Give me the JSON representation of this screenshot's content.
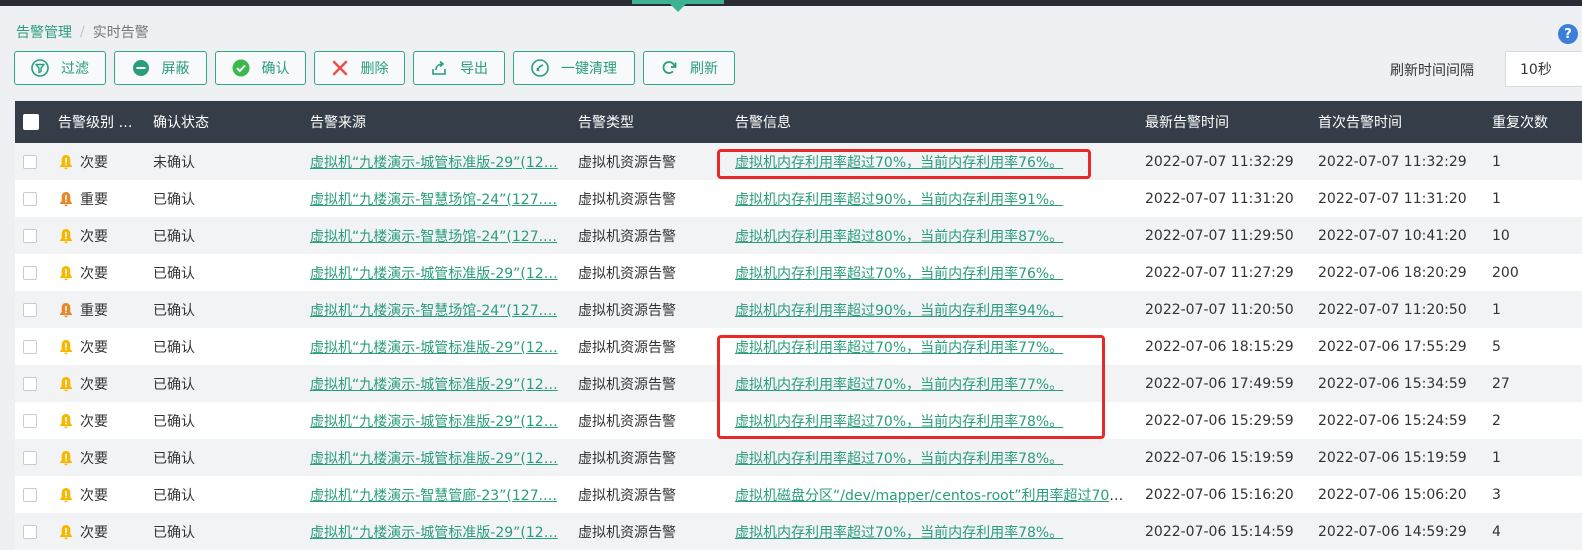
{
  "breadcrumb": {
    "parent": "告警管理",
    "separator": "/",
    "current": "实时告警"
  },
  "toolbar": {
    "filter": "过滤",
    "mask": "屏蔽",
    "confirm": "确认",
    "delete": "删除",
    "export": "导出",
    "clean": "一键清理",
    "refresh": "刷新"
  },
  "refresh_interval": {
    "label": "刷新时间间隔",
    "value": "10秒"
  },
  "colors": {
    "accent": "#2a9d7c",
    "header": "#353d49",
    "minor_level": "#f5b700",
    "major_level": "#e8862a",
    "highlight": "#e8292a"
  },
  "table": {
    "headers": [
      "告警级别 …",
      "确认状态",
      "告警来源",
      "告警类型",
      "告警信息",
      "最新告警时间",
      "首次告警时间",
      "重复次数"
    ],
    "rows": [
      {
        "level": "次要",
        "status": "未确认",
        "source": "虚拟机“九楼演示-城管标准版-29”(12…",
        "type": "虚拟机资源告警",
        "info": "虚拟机内存利用率超过70%，当前内存利用率76%。",
        "latest": "2022-07-07 11:32:29",
        "first": "2022-07-07 11:32:29",
        "repeat": "1"
      },
      {
        "level": "重要",
        "status": "已确认",
        "source": "虚拟机“九楼演示-智慧场馆-24”(127.…",
        "type": "虚拟机资源告警",
        "info": "虚拟机内存利用率超过90%，当前内存利用率91%。",
        "latest": "2022-07-07 11:31:20",
        "first": "2022-07-07 11:31:20",
        "repeat": "1"
      },
      {
        "level": "次要",
        "status": "已确认",
        "source": "虚拟机“九楼演示-智慧场馆-24”(127.…",
        "type": "虚拟机资源告警",
        "info": "虚拟机内存利用率超过80%，当前内存利用率87%。",
        "latest": "2022-07-07 11:29:50",
        "first": "2022-07-07 10:41:20",
        "repeat": "10"
      },
      {
        "level": "次要",
        "status": "已确认",
        "source": "虚拟机“九楼演示-城管标准版-29”(12…",
        "type": "虚拟机资源告警",
        "info": "虚拟机内存利用率超过70%，当前内存利用率76%。",
        "latest": "2022-07-07 11:27:29",
        "first": "2022-07-06 18:20:29",
        "repeat": "200"
      },
      {
        "level": "重要",
        "status": "已确认",
        "source": "虚拟机“九楼演示-智慧场馆-24”(127.…",
        "type": "虚拟机资源告警",
        "info": "虚拟机内存利用率超过90%，当前内存利用率94%。",
        "latest": "2022-07-07 11:20:50",
        "first": "2022-07-07 11:20:50",
        "repeat": "1"
      },
      {
        "level": "次要",
        "status": "已确认",
        "source": "虚拟机“九楼演示-城管标准版-29”(12…",
        "type": "虚拟机资源告警",
        "info": "虚拟机内存利用率超过70%，当前内存利用率77%。",
        "latest": "2022-07-06 18:15:29",
        "first": "2022-07-06 17:55:29",
        "repeat": "5"
      },
      {
        "level": "次要",
        "status": "已确认",
        "source": "虚拟机“九楼演示-城管标准版-29”(12…",
        "type": "虚拟机资源告警",
        "info": "虚拟机内存利用率超过70%，当前内存利用率77%。",
        "latest": "2022-07-06 17:49:59",
        "first": "2022-07-06 15:34:59",
        "repeat": "27"
      },
      {
        "level": "次要",
        "status": "已确认",
        "source": "虚拟机“九楼演示-城管标准版-29”(12…",
        "type": "虚拟机资源告警",
        "info": "虚拟机内存利用率超过70%，当前内存利用率78%。",
        "latest": "2022-07-06 15:29:59",
        "first": "2022-07-06 15:24:59",
        "repeat": "2"
      },
      {
        "level": "次要",
        "status": "已确认",
        "source": "虚拟机“九楼演示-城管标准版-29”(12…",
        "type": "虚拟机资源告警",
        "info": "虚拟机内存利用率超过70%，当前内存利用率78%。",
        "latest": "2022-07-06 15:19:59",
        "first": "2022-07-06 15:19:59",
        "repeat": "1"
      },
      {
        "level": "次要",
        "status": "已确认",
        "source": "虚拟机“九楼演示-智慧管廊-23”(127.…",
        "type": "虚拟机资源告警",
        "info": "虚拟机磁盘分区“/dev/mapper/centos-root”利用率超过70%…",
        "latest": "2022-07-06 15:16:20",
        "first": "2022-07-06 15:06:20",
        "repeat": "3"
      },
      {
        "level": "次要",
        "status": "已确认",
        "source": "虚拟机“九楼演示-城管标准版-29”(12…",
        "type": "虚拟机资源告警",
        "info": "虚拟机内存利用率超过70%，当前内存利用率78%。",
        "latest": "2022-07-06 15:14:59",
        "first": "2022-07-06 14:59:29",
        "repeat": "4"
      }
    ]
  }
}
